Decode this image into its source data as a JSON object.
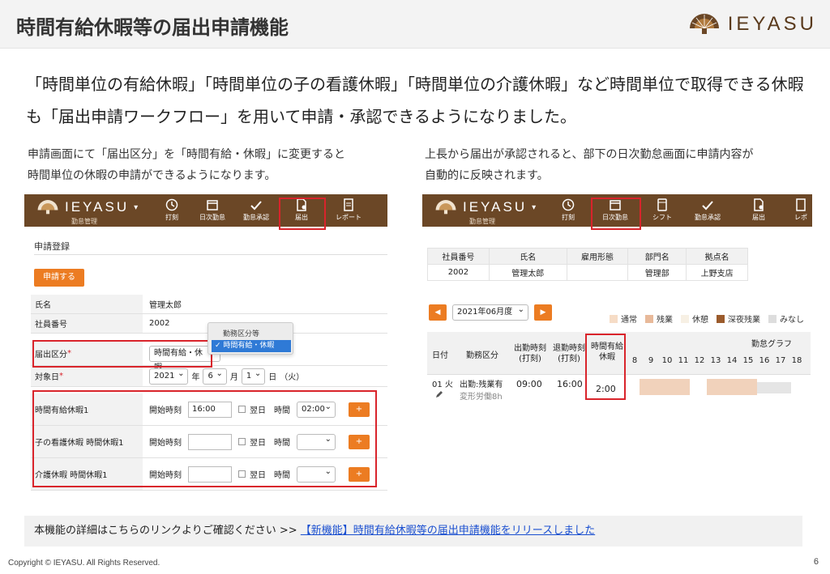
{
  "header": {
    "title": "時間有給休暇等の届出申請機能",
    "brand": "IEYASU"
  },
  "intro": "「時間単位の有給休暇」「時間単位の子の看護休暇」「時間単位の介護休暇」など時間単位で取得できる休暇も「届出申請ワークフロー」を用いて申請・承認できるようになりました。",
  "left_note": {
    "line1": "申請画面にて「届出区分」を「時間有給・休暇」に変更すると",
    "line2": "時間単位の休暇の申請ができるようになります。"
  },
  "right_note": {
    "line1": "上長から届出が承認されると、部下の日次勤怠画面に申請内容が",
    "line2": "自動的に反映されます。"
  },
  "left_app": {
    "logo": "IEYASU",
    "logo_caret": "▾",
    "subtitle": "勤怠管理",
    "nav": [
      "打刻",
      "日次勤怠",
      "勤怠承認",
      "届出",
      "レポート"
    ],
    "section_title": "申請登録",
    "apply_button": "申請する",
    "name_label": "氏名",
    "name_value": "管理太郎",
    "emp_label": "社員番号",
    "emp_value": "2002",
    "type_label": "届出区分",
    "type_value": "時間有給・休暇",
    "required_mark": "*",
    "date_label": "対象日",
    "date_year": "2021",
    "date_year_unit": "年",
    "date_month": "6",
    "date_month_unit": "月",
    "date_day": "1",
    "date_day_unit": "日",
    "date_weekday": "（火）",
    "popup_head": "勤務区分等",
    "popup_option": "時間有給・休暇",
    "popup_check": "✓",
    "rows": [
      {
        "label": "時間有給休暇1",
        "start_label": "開始時刻",
        "start_value": "16:00",
        "next_day": "翌日",
        "time_label": "時間",
        "time_value": "02:00",
        "plus": "+"
      },
      {
        "label": "子の看護休暇 時間休暇1",
        "start_label": "開始時刻",
        "start_value": "",
        "next_day": "翌日",
        "time_label": "時間",
        "time_value": "",
        "plus": "+"
      },
      {
        "label": "介護休暇 時間休暇1",
        "start_label": "開始時刻",
        "start_value": "",
        "next_day": "翌日",
        "time_label": "時間",
        "time_value": "",
        "plus": "+"
      }
    ]
  },
  "right_app": {
    "logo": "IEYASU",
    "logo_caret": "▾",
    "subtitle": "勤怠管理",
    "nav": [
      "打刻",
      "日次勤怠",
      "シフト",
      "勤怠承認",
      "届出",
      "レポ"
    ],
    "emp_table": {
      "headers": [
        "社員番号",
        "氏名",
        "雇用形態",
        "部門名",
        "拠点名"
      ],
      "values": [
        "2002",
        "管理太郎",
        "",
        "管理部",
        "上野支店"
      ]
    },
    "prev_button": "◀",
    "next_button": "▶",
    "month_value": "2021年06月度",
    "legend": [
      {
        "label": "通常",
        "color": "#f6dcc6"
      },
      {
        "label": "残業",
        "color": "#e8b99a"
      },
      {
        "label": "休憩",
        "color": "#f7f0e4"
      },
      {
        "label": "深夜残業",
        "color": "#9b5b2c"
      },
      {
        "label": "みなし",
        "color": "#dddddd"
      }
    ],
    "daily": {
      "col_date": "日付",
      "col_type": "勤務区分",
      "col_in": "出勤時刻\n(打刻)",
      "col_out": "退勤時刻\n(打刻)",
      "col_paid": "時間有給\n休暇",
      "graph_title": "勤怠グラフ",
      "hours": [
        "8",
        "9",
        "10",
        "11",
        "12",
        "13",
        "14",
        "15",
        "16",
        "17",
        "18"
      ],
      "row_date": "01 火",
      "row_type": "出勤:残業有",
      "row_type_sub": "変形労働8h",
      "row_in": "09:00",
      "row_out": "16:00",
      "row_paid": "2:00"
    }
  },
  "footer": {
    "text": "本機能の詳細はこちらのリンクよりご確認ください >> ",
    "link": "【新機能】時間有給休暇等の届出申請機能をリリースしました"
  },
  "copyright": "Copyright © IEYASU. All Rights Reserved.",
  "page_number": "6",
  "colors": {
    "brand_brown": "#6b4726",
    "accent_orange": "#ec7c22",
    "highlight_red": "#d9242b"
  },
  "icons": [
    "fan-logo-icon",
    "clock-icon",
    "calendar-icon",
    "check-icon",
    "document-icon",
    "report-icon",
    "shift-icon",
    "pencil-icon"
  ]
}
